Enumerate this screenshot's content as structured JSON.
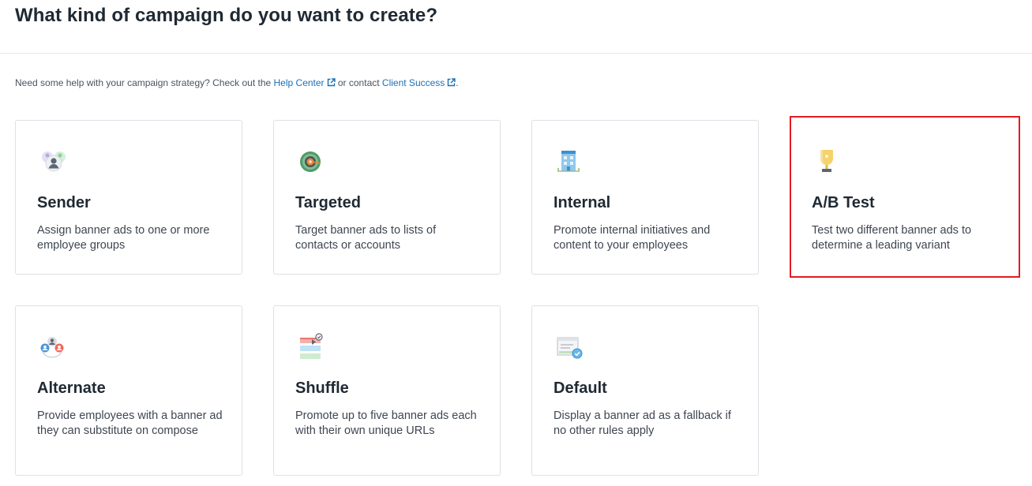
{
  "header": {
    "title": "What kind of campaign do you want to create?"
  },
  "help": {
    "prefix": "Need some help with your campaign strategy? Check out the ",
    "help_center": "Help Center",
    "middle": " or contact ",
    "client_success": "Client Success",
    "suffix": "."
  },
  "colors": {
    "link": "#1d6fb5",
    "selected_border": "#e31b23"
  },
  "cards": [
    {
      "icon": "users-group-icon",
      "title": "Sender",
      "description": "Assign banner ads to one or more employee groups",
      "selected": false
    },
    {
      "icon": "target-icon",
      "title": "Targeted",
      "description": "Target banner ads to lists of contacts or accounts",
      "selected": false
    },
    {
      "icon": "building-icon",
      "title": "Internal",
      "description": "Promote internal initiatives and content to your employees",
      "selected": false
    },
    {
      "icon": "trophy-icon",
      "title": "A/B Test",
      "description": "Test two different banner ads to determine a leading variant",
      "selected": true
    },
    {
      "icon": "people-swap-icon",
      "title": "Alternate",
      "description": "Provide employees with a banner ad they can substitute on compose",
      "selected": false
    },
    {
      "icon": "shuffle-banners-icon",
      "title": "Shuffle",
      "description": "Promote up to five banner ads each with their own unique URLs",
      "selected": false
    },
    {
      "icon": "default-window-icon",
      "title": "Default",
      "description": "Display a banner ad as a fallback if no other rules apply",
      "selected": false
    }
  ]
}
